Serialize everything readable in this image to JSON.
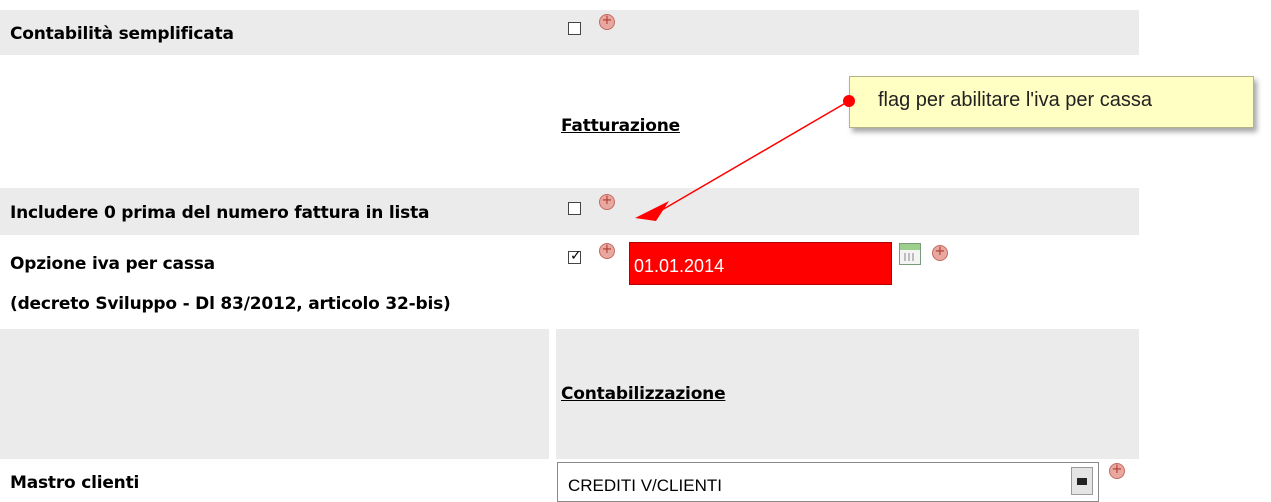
{
  "rows": {
    "contabilita": {
      "label": "Contabilità semplificata",
      "checked": false
    },
    "fatturazione_title": "Fatturazione",
    "includere_zero": {
      "label": "Includere 0 prima del numero fattura in lista",
      "checked": false
    },
    "iva_cassa": {
      "label": "Opzione iva per cassa",
      "sub_label": "(decreto Sviluppo - Dl 83/2012, articolo 32-bis)",
      "checked": true,
      "date_value": "01.01.2014"
    },
    "contabilizzazione_title": "Contabilizzazione",
    "mastro_clienti": {
      "label": "Mastro clienti",
      "select_value": "CREDITI V/CLIENTI"
    }
  },
  "callout": {
    "text": "flag per abilitare l'iva per cassa"
  },
  "colors": {
    "field_error": "#ff0000",
    "band": "#ebebeb",
    "tooltip_bg": "#ffffc4",
    "arrow": "#ff0000"
  },
  "icons": [
    "add-circle-icon",
    "calendar-icon",
    "dropdown-arrow-icon"
  ]
}
